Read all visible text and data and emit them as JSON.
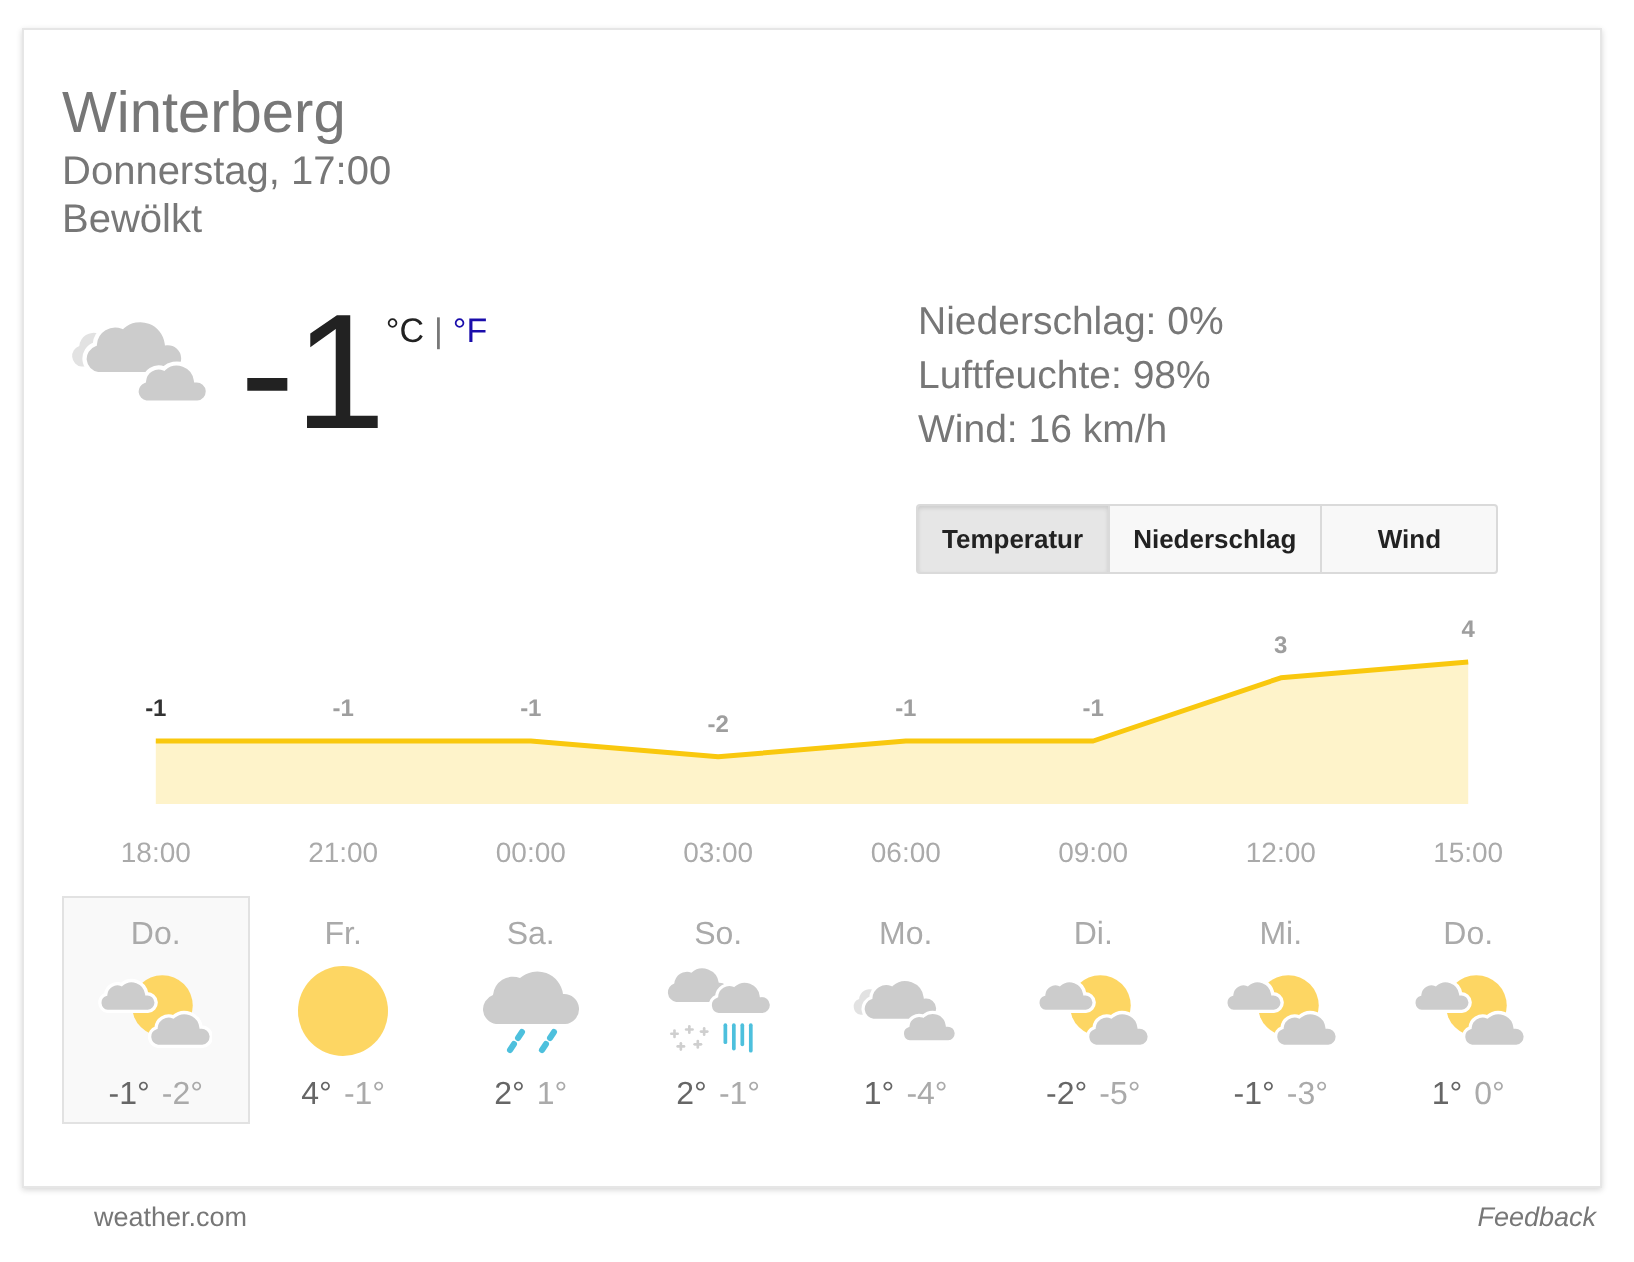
{
  "location": {
    "title": "Winterberg",
    "datetime": "Donnerstag, 17:00",
    "condition": "Bewölkt"
  },
  "current": {
    "kind": "cloudy",
    "temperature": "-1",
    "units": [
      {
        "label": "°C",
        "selected": true
      },
      {
        "label": "°F",
        "selected": false
      }
    ],
    "separator": "|"
  },
  "details": [
    "Niederschlag: 0%",
    "Luftfeuchte: 98%",
    "Wind: 16 km/h"
  ],
  "chart_tabs": [
    {
      "label": "Temperatur",
      "selected": true
    },
    {
      "label": "Niederschlag",
      "selected": false
    },
    {
      "label": "Wind",
      "selected": false
    }
  ],
  "hourly": {
    "chart_data": {
      "type": "area",
      "categories": [
        "18:00",
        "21:00",
        "00:00",
        "03:00",
        "06:00",
        "09:00",
        "12:00",
        "15:00"
      ],
      "series": [
        {
          "color": "#f9c80e",
          "values": [
            -1,
            -1,
            -1,
            -2,
            -1,
            -1,
            3,
            4
          ]
        }
      ],
      "data_labels": true
    },
    "points": [
      {
        "selected": true
      },
      {
        "selected": false
      },
      {
        "selected": false
      },
      {
        "selected": false
      },
      {
        "selected": false
      },
      {
        "selected": false
      },
      {
        "selected": false
      },
      {
        "selected": false
      }
    ]
  },
  "days": [
    {
      "day": "Do.",
      "kind": "partlycloudy",
      "high": "-1°",
      "low": "-2°",
      "selected": true
    },
    {
      "day": "Fr.",
      "kind": "sunny",
      "high": "4°",
      "low": "-1°",
      "selected": false
    },
    {
      "day": "Sa.",
      "kind": "rain",
      "high": "2°",
      "low": "1°",
      "selected": false
    },
    {
      "day": "So.",
      "kind": "sleet",
      "high": "2°",
      "low": "-1°",
      "selected": false
    },
    {
      "day": "Mo.",
      "kind": "cloudy",
      "high": "1°",
      "low": "-4°",
      "selected": false
    },
    {
      "day": "Di.",
      "kind": "partlycloudy",
      "high": "-2°",
      "low": "-5°",
      "selected": false
    },
    {
      "day": "Mi.",
      "kind": "partlycloudy",
      "high": "-1°",
      "low": "-3°",
      "selected": false
    },
    {
      "day": "Do.",
      "kind": "partlycloudy",
      "high": "1°",
      "low": "0°",
      "selected": false
    }
  ],
  "footer": {
    "source": "weather.com",
    "feedback": "Feedback"
  }
}
